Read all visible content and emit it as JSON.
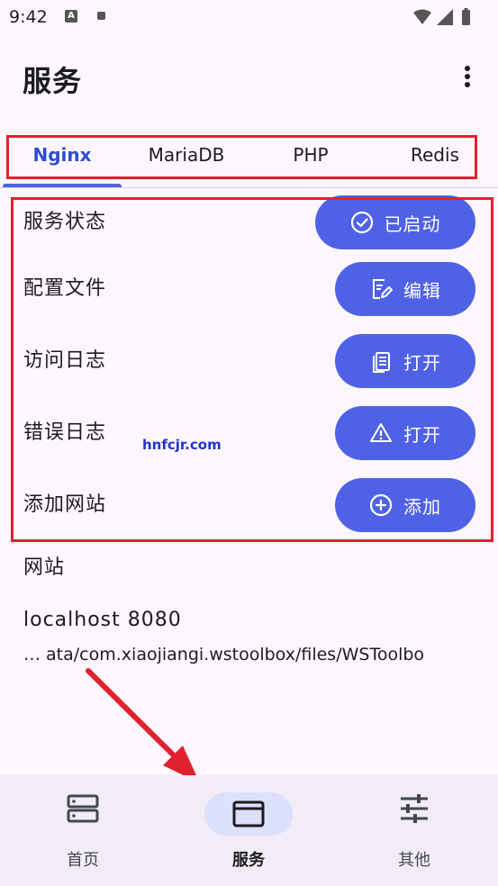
{
  "status_bar": {
    "time": "9:42",
    "icons": [
      "a-icon",
      "square-icon",
      "wifi-icon",
      "signal-icon",
      "battery-icon"
    ]
  },
  "appbar": {
    "title": "服务"
  },
  "tabs": [
    {
      "label": "Nginx",
      "active": true
    },
    {
      "label": "MariaDB",
      "active": false
    },
    {
      "label": "PHP",
      "active": false
    },
    {
      "label": "Redis",
      "active": false
    }
  ],
  "rows": [
    {
      "label": "服务状态",
      "button": "已启动",
      "icon": "check-circle-icon"
    },
    {
      "label": "配置文件",
      "button": "编辑",
      "icon": "edit-doc-icon"
    },
    {
      "label": "访问日志",
      "button": "打开",
      "icon": "copy-doc-icon"
    },
    {
      "label": "错误日志",
      "button": "打开",
      "icon": "warning-icon"
    },
    {
      "label": "添加网站",
      "button": "添加",
      "icon": "add-circle-icon"
    }
  ],
  "sites": {
    "title": "网站",
    "items": [
      {
        "name": "localhost  8080",
        "path": "… ata/com.xiaojiangi.wstoolbox/files/WSToolbo"
      }
    ]
  },
  "watermark": "hnfcjr.com",
  "bottom_nav": [
    {
      "label": "首页",
      "icon": "server-icon",
      "active": false
    },
    {
      "label": "服务",
      "icon": "window-icon",
      "active": true
    },
    {
      "label": "其他",
      "icon": "sliders-icon",
      "active": false
    }
  ],
  "colors": {
    "accent": "#4f62e6",
    "annotation": "#e0212e"
  }
}
